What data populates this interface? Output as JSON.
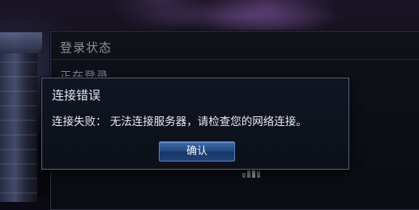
{
  "status_panel": {
    "title": "登录状态",
    "status_text": "正在登录……"
  },
  "error_dialog": {
    "title": "连接错误",
    "message": "连接失败： 无法连接服务器，请检查您的网络连接。",
    "confirm_label": "确认"
  },
  "colors": {
    "button_accent": "#23497f",
    "dialog_border": "#5b6274",
    "panel_text": "#8b8f9c"
  }
}
